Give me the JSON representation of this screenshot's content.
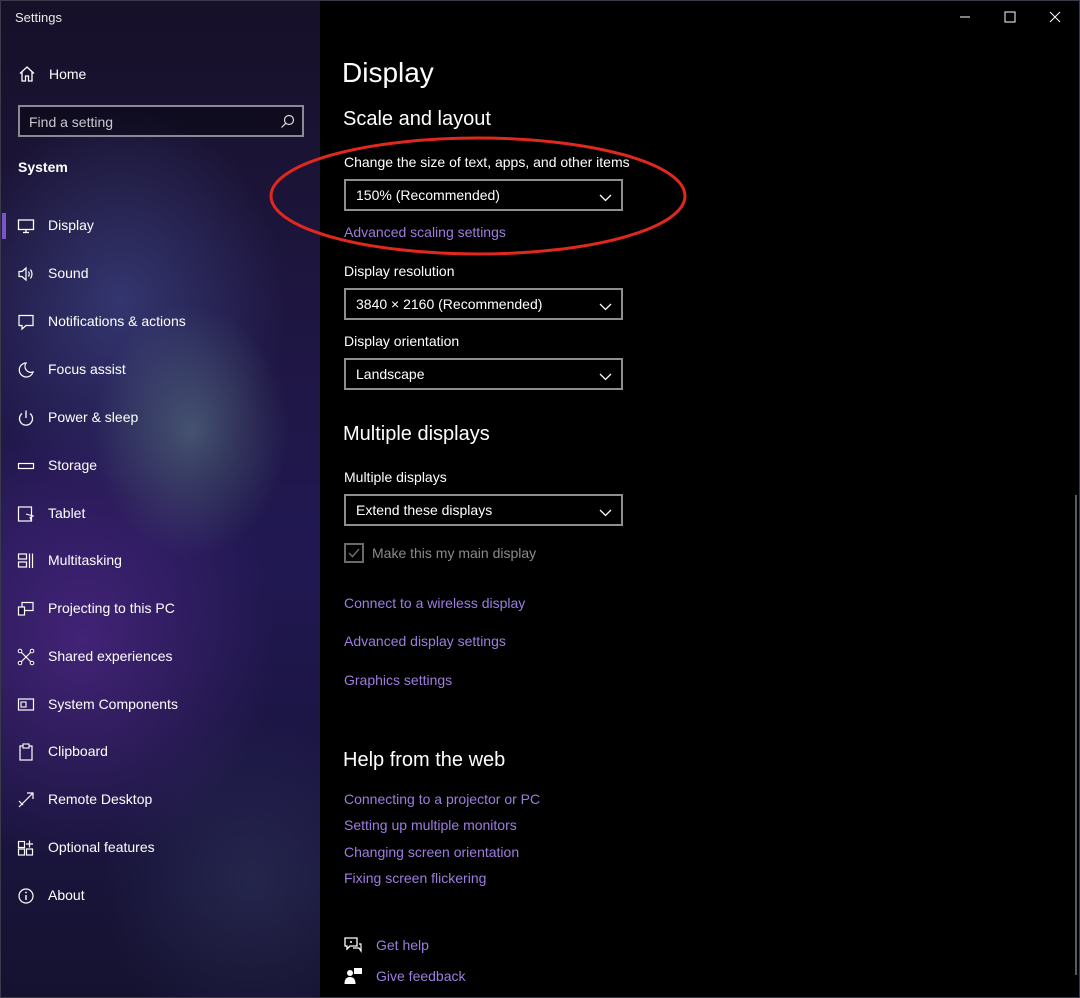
{
  "window": {
    "title": "Settings",
    "controls": {
      "minimize": "minimize-icon",
      "maximize": "maximize-icon",
      "close": "close-icon"
    }
  },
  "sidebar": {
    "home_label": "Home",
    "search": {
      "placeholder": "Find a setting",
      "value": ""
    },
    "section_label": "System",
    "accent_color": "#7b55c7",
    "items": [
      {
        "label": "Display",
        "icon": "monitor-icon",
        "active": true
      },
      {
        "label": "Sound",
        "icon": "speaker-icon"
      },
      {
        "label": "Notifications & actions",
        "icon": "notification-icon"
      },
      {
        "label": "Focus assist",
        "icon": "moon-icon"
      },
      {
        "label": "Power & sleep",
        "icon": "power-icon"
      },
      {
        "label": "Storage",
        "icon": "storage-icon"
      },
      {
        "label": "Tablet",
        "icon": "tablet-icon"
      },
      {
        "label": "Multitasking",
        "icon": "multitasking-icon"
      },
      {
        "label": "Projecting to this PC",
        "icon": "projecting-icon"
      },
      {
        "label": "Shared experiences",
        "icon": "shared-experiences-icon"
      },
      {
        "label": "System Components",
        "icon": "system-components-icon"
      },
      {
        "label": "Clipboard",
        "icon": "clipboard-icon"
      },
      {
        "label": "Remote Desktop",
        "icon": "remote-desktop-icon"
      },
      {
        "label": "Optional features",
        "icon": "optional-features-icon"
      },
      {
        "label": "About",
        "icon": "info-icon"
      }
    ]
  },
  "main": {
    "title": "Display",
    "scale_layout": {
      "heading": "Scale and layout",
      "scale_label": "Change the size of text, apps, and other items",
      "scale_value": "150% (Recommended)",
      "advanced_scaling_link": "Advanced scaling settings",
      "resolution_label": "Display resolution",
      "resolution_value": "3840 × 2160 (Recommended)",
      "orientation_label": "Display orientation",
      "orientation_value": "Landscape"
    },
    "multiple_displays": {
      "heading": "Multiple displays",
      "label": "Multiple displays",
      "value": "Extend these displays",
      "main_display_checkbox": "Make this my main display",
      "main_display_checked": true,
      "links": [
        "Connect to a wireless display",
        "Advanced display settings",
        "Graphics settings"
      ]
    },
    "help": {
      "heading": "Help from the web",
      "links": [
        "Connecting to a projector or PC",
        "Setting up multiple monitors",
        "Changing screen orientation",
        "Fixing screen flickering"
      ]
    },
    "footer": {
      "get_help": "Get help",
      "give_feedback": "Give feedback"
    },
    "link_color": "#9d7de0",
    "annotation_color": "#e0281e"
  }
}
